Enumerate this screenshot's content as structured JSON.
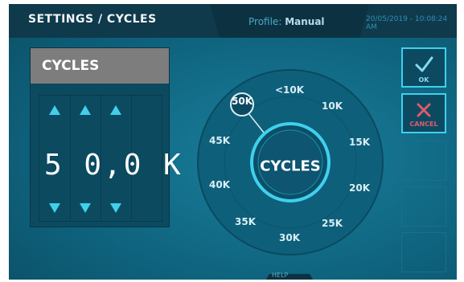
{
  "header": {
    "title": "SETTINGS / CYCLES",
    "profile_label": "Profile:",
    "profile_value": "Manual",
    "datetime": "20/05/2019 - 10:08:24 AM"
  },
  "panel": {
    "title": "CYCLES",
    "value": "5 0,0 K"
  },
  "dial": {
    "center_label": "CYCLES",
    "selected": "50K",
    "options": [
      "<10K",
      "10K",
      "15K",
      "20K",
      "25K",
      "30K",
      "35K",
      "40K",
      "45K",
      "50K"
    ]
  },
  "buttons": {
    "ok_label": "OK",
    "cancel_label": "CANCEL",
    "help_label": "HELP"
  },
  "icons": [
    "check-icon",
    "x-icon",
    "arrow-up-icon",
    "arrow-down-icon"
  ],
  "colors": {
    "accent": "#3fd0ec",
    "header_bg": "#0f3a4c",
    "panel_title_bg": "#7d7d7d",
    "cancel_red": "#e05a6a"
  }
}
